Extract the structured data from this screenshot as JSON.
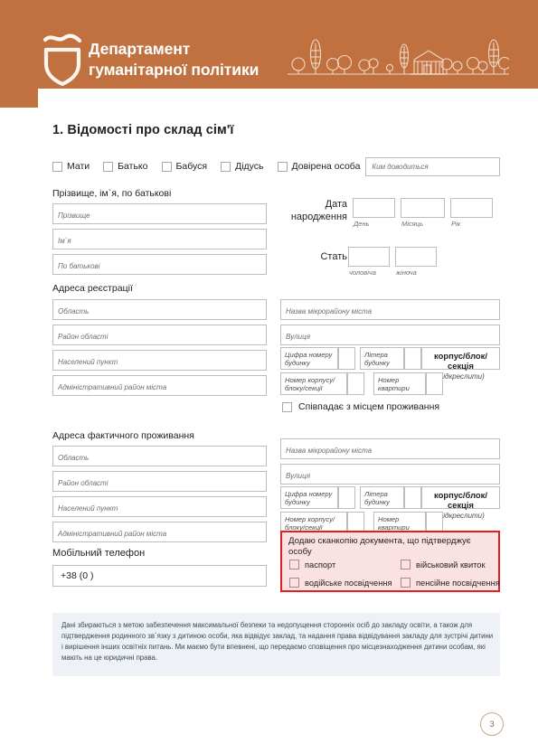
{
  "header": {
    "brand": "Департамент\nгуманітарної політики",
    "logo_icon": "shield-logo-icon",
    "skyline_icon": "city-skyline-illustration",
    "bg_color": "#c1713f"
  },
  "section": {
    "title": "1. Відомості про склад сім'ї"
  },
  "roles": {
    "items": [
      {
        "label": "Мати"
      },
      {
        "label": "Батько"
      },
      {
        "label": "Бабуся"
      },
      {
        "label": "Дідусь"
      },
      {
        "label": "Довірена особа"
      }
    ],
    "relation_input": {
      "placeholder": "Ким доводиться",
      "value": ""
    }
  },
  "fullname": {
    "label": "Прізвище, ім`я, по батькові",
    "fields": [
      {
        "placeholder": "Прізвище",
        "value": ""
      },
      {
        "placeholder": "Ім`я",
        "value": ""
      },
      {
        "placeholder": "По батькові",
        "value": ""
      }
    ]
  },
  "birth": {
    "label": "Дата\nнародження",
    "parts": [
      {
        "caption": "День",
        "value": ""
      },
      {
        "caption": "Місяць",
        "value": ""
      },
      {
        "caption": "Рік",
        "value": ""
      }
    ]
  },
  "gender": {
    "label": "Стать",
    "options": [
      {
        "caption": "чоловіча",
        "value": ""
      },
      {
        "caption": "жіноча",
        "value": ""
      }
    ]
  },
  "registration_address": {
    "label": "Адреса реєстрації",
    "left_fields": [
      {
        "placeholder": "Область",
        "value": ""
      },
      {
        "placeholder": "Район області",
        "value": ""
      },
      {
        "placeholder": "Населений пункт",
        "value": ""
      },
      {
        "placeholder": "Адміністративний район міста",
        "value": ""
      }
    ],
    "right_fields": [
      {
        "placeholder": "Назва мікрорайону міста",
        "value": ""
      },
      {
        "placeholder": "Вулиця",
        "value": ""
      }
    ],
    "house_row": {
      "digit_label": "Цифра номеру\nбудинку",
      "letter_label": "Літера\nбудинку",
      "section_label": "корпус/блок/секція",
      "section_note": "(підкреслити)",
      "digit_value": "",
      "letter_value": ""
    },
    "apartment_row": {
      "block_label": "Номер корпусу/\nблоку/секції",
      "flat_label": "Номер\nквартири",
      "block_value": "",
      "flat_value": ""
    },
    "same_as_living": "Співпадає з місцем проживання"
  },
  "actual_address": {
    "label": "Адреса фактичного проживання",
    "left_fields": [
      {
        "placeholder": "Область",
        "value": ""
      },
      {
        "placeholder": "Район області",
        "value": ""
      },
      {
        "placeholder": "Населений пункт",
        "value": ""
      },
      {
        "placeholder": "Адміністративний район міста",
        "value": ""
      }
    ],
    "right_fields": [
      {
        "placeholder": "Назва мікрорайону міста",
        "value": ""
      },
      {
        "placeholder": "Вулиця",
        "value": ""
      }
    ],
    "house_row": {
      "digit_label": "Цифра номеру\nбудинку",
      "letter_label": "Літера\nбудинку",
      "section_label": "корпус/блок/секція",
      "section_note": "(підкреслити)",
      "digit_value": "",
      "letter_value": ""
    },
    "apartment_row": {
      "block_label": "Номер корпусу/\nблоку/секції",
      "flat_label": "Номер\nквартири",
      "block_value": "",
      "flat_value": ""
    }
  },
  "phone": {
    "label": "Мобільний телефон",
    "value": "+38 (0          )"
  },
  "documents": {
    "title": "Додаю сканкопію документа, що підтверджує особу",
    "border_color": "#e02020",
    "bg_color": "#fbe2e2",
    "options": [
      {
        "label": "паспорт"
      },
      {
        "label": "військовий квиток"
      },
      {
        "label": "водійське посвідчення"
      },
      {
        "label": "пенсійне посвідчення"
      }
    ]
  },
  "note": {
    "text": "Дані збираються з метою забезпечення максимальної безпеки та недопущення сторонніх осіб до закладу освіти, а також для підтвердження родинного зв`язку з дитиною особи, яка відвідує заклад, та надання права відвідування закладу для зустрічі дитини і вирішення інших освітніх питань. Ми маємо бути впевнені, що передаємо сповіщення про місцезнаходження дитини особам, які мають на це юридичні права."
  },
  "page_number": "3"
}
